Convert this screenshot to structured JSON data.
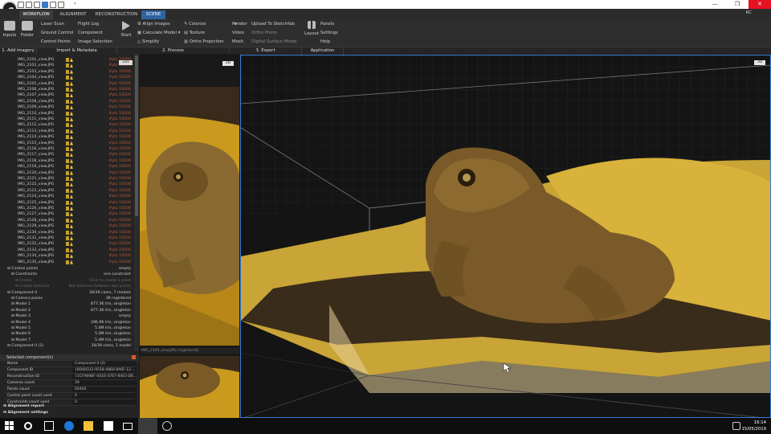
{
  "window": {
    "title": "*",
    "qa_icons": 6
  },
  "tabs": [
    {
      "label": "WORKFLOW"
    },
    {
      "label": "ALIGNMENT"
    },
    {
      "label": "RECONSTRUCTION"
    },
    {
      "label": "SCENE"
    }
  ],
  "user": "RC",
  "ribbon": {
    "inputs": "Inputs",
    "folder": "Folder",
    "import_col1": [
      "Laser Scan",
      "Ground Control",
      "Control Points"
    ],
    "import_col2": [
      "Flight Log",
      "Component",
      "Image Selection"
    ],
    "start": "Start",
    "process_col1": [
      "Align Images",
      "Calculate Model",
      "Simplify"
    ],
    "process_col2": [
      "Colorize",
      "Texture",
      "Ortho Projection"
    ],
    "export_col1": [
      "Render",
      "Video",
      "Mesh"
    ],
    "export_col2": [
      "Upload To Sketchfab",
      "Ortho Photo",
      "Digital Surface Model"
    ],
    "layout": "Layout",
    "app_col": [
      "Panels",
      "Settings",
      "Help"
    ]
  },
  "groups": [
    {
      "label": "1. Add imagery"
    },
    {
      "label": "Import & Metadata"
    },
    {
      "label": "2. Process"
    },
    {
      "label": "3. Export"
    },
    {
      "label": "Application"
    }
  ],
  "image_list": {
    "prior_label": "#ptz 19200",
    "images": [
      "IMG_2101_view.JPG",
      "IMG_2102_view.JPG",
      "IMG_2103_view.JPG",
      "IMG_2104_view.JPG",
      "IMG_2105_view.JPG",
      "IMG_2106_view.JPG",
      "IMG_2107_view.JPG",
      "IMG_2108_view.JPG",
      "IMG_2109_view.JPG",
      "IMG_2110_view.JPG",
      "IMG_2111_view.JPG",
      "IMG_2112_view.JPG",
      "IMG_2113_view.JPG",
      "IMG_2114_view.JPG",
      "IMG_2115_view.JPG",
      "IMG_2116_view.JPG",
      "IMG_2117_view.JPG",
      "IMG_2118_view.JPG",
      "IMG_2119_view.JPG",
      "IMG_2120_view.JPG",
      "IMG_2121_view.JPG",
      "IMG_2122_view.JPG",
      "IMG_2123_view.JPG",
      "IMG_2124_view.JPG",
      "IMG_2125_view.JPG",
      "IMG_2126_view.JPG",
      "IMG_2127_view.JPG",
      "IMG_2128_view.JPG",
      "IMG_2129_view.JPG",
      "IMG_2130_view.JPG",
      "IMG_2131_view.JPG",
      "IMG_2132_view.JPG",
      "IMG_2133_view.JPG",
      "IMG_2134_view.JPG",
      "IMG_2135_view.JPG"
    ],
    "view_tag": "1Ds"
  },
  "tree": [
    {
      "label": "Control points",
      "value": "empty",
      "indent": 1,
      "dim": false
    },
    {
      "label": "Constraints",
      "value": "one constraint",
      "indent": 2,
      "dim": false
    },
    {
      "label": "Create",
      "value": "Click to create a point",
      "indent": 3,
      "dim": true
    },
    {
      "label": "Create distance",
      "value": "Not distance between two points",
      "indent": 3,
      "dim": true
    },
    {
      "label": "Component 0",
      "value": "39/39 cams, 7 models",
      "indent": 1,
      "dim": false
    },
    {
      "label": "Camera poses",
      "value": "39 registered",
      "indent": 2,
      "dim": false
    },
    {
      "label": "Model 1",
      "value": "877.3K tris, singleton",
      "indent": 2,
      "dim": false
    },
    {
      "label": "Model 2",
      "value": "877.3K tris, singleton",
      "indent": 2,
      "dim": false
    },
    {
      "label": "Model 3",
      "value": "empty",
      "indent": 2,
      "dim": false
    },
    {
      "label": "Model 4",
      "value": "296.9K tris, singleton",
      "indent": 2,
      "dim": false
    },
    {
      "label": "Model 5",
      "value": "5.4M tris, singleton",
      "indent": 2,
      "dim": false
    },
    {
      "label": "Model 6",
      "value": "5.4M tris, singleton",
      "indent": 2,
      "dim": false
    },
    {
      "label": "Model 7",
      "value": "5.4M tris, singleton",
      "indent": 2,
      "dim": false
    },
    {
      "label": "Component 0 (1)",
      "value": "39/39 cams, 1 model",
      "indent": 1,
      "dim": false
    }
  ],
  "selected": {
    "header": "Selected component(s)",
    "rows": [
      {
        "k": "Name",
        "v": "Component 0 (2)"
      },
      {
        "k": "Component ID",
        "v": "{8D69332-9558-4860-8A6F-12..."
      },
      {
        "k": "Reconstruction ID",
        "v": "{1CF969BF-0016-4767-8403-D6..."
      },
      {
        "k": "Cameras count",
        "v": "39"
      },
      {
        "k": "Points count",
        "v": "60400"
      },
      {
        "k": "Control point count used",
        "v": "0"
      },
      {
        "k": "Constraints count used",
        "v": "0"
      }
    ],
    "sections": [
      "Alignment report",
      "Alignment settings"
    ]
  },
  "view2d": {
    "tag": "2D",
    "caption": "IMG_2109_view.JPG (registered)"
  },
  "view3d": {
    "tag": "3D"
  },
  "clock": {
    "time": "16:14",
    "date": "15/05/2019"
  },
  "colors": {
    "accent": "#2f63a0",
    "warning": "#e6c238",
    "close": "#e81123"
  }
}
